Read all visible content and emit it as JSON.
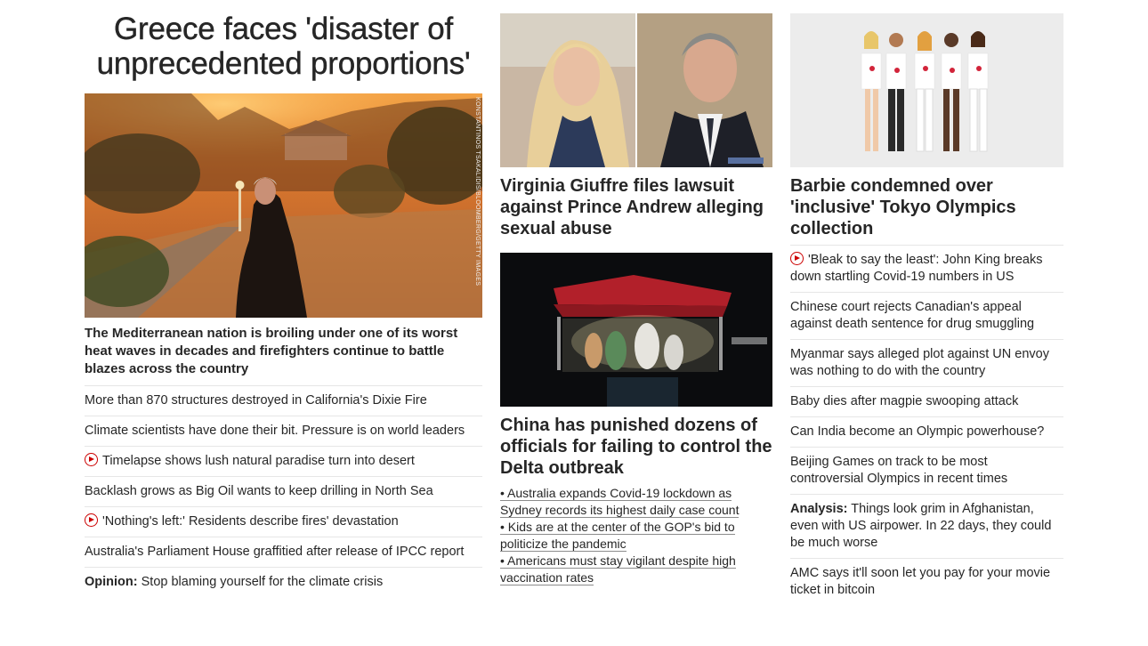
{
  "hero": {
    "title": "Greece faces 'disaster of unprecedented proportions'",
    "image_credit": "KONSTANTINOS TSAKALIDIS/BLOOMBERG/GETTY IMAGES",
    "subtitle": "The Mediterranean nation is broiling under one of its worst heat waves in decades and firefighters continue to battle blazes across the country",
    "links": [
      {
        "text": "More than 870 structures destroyed in California's Dixie Fire",
        "video": false
      },
      {
        "text": "Climate scientists have done their bit. Pressure is on world leaders",
        "video": false
      },
      {
        "text": "Timelapse shows lush natural paradise turn into desert",
        "video": true
      },
      {
        "text": "Backlash grows as Big Oil wants to keep drilling in North Sea",
        "video": false
      },
      {
        "text": "'Nothing's left:' Residents describe fires' devastation",
        "video": true
      },
      {
        "text": "Australia's Parliament House graffitied after release of IPCC report",
        "video": false
      }
    ],
    "opinion": {
      "label": "Opinion:",
      "text": " Stop blaming yourself for the climate crisis"
    }
  },
  "middle": {
    "story1": {
      "title": "Virginia Giuffre files lawsuit against Prince Andrew alleging sexual abuse"
    },
    "story2": {
      "title": "China has punished dozens of officials for failing to control the Delta outbreak",
      "bullets": [
        "• Australia expands Covid-19 lockdown as Sydney records its highest daily case count",
        "• Kids are at the center of the GOP's bid to politicize the pandemic",
        "• Americans must stay vigilant despite high vaccination rates"
      ]
    }
  },
  "right": {
    "story": {
      "title": "Barbie condemned over 'inclusive' Tokyo Olympics collection"
    },
    "links": [
      {
        "text": "'Bleak to say the least': John King breaks down startling Covid-19 numbers in US",
        "video": true
      },
      {
        "text": "Chinese court rejects Canadian's appeal against death sentence for drug smuggling",
        "video": false
      },
      {
        "text": "Myanmar says alleged plot against UN envoy was nothing to do with the country",
        "video": false
      },
      {
        "text": "Baby dies after magpie swooping attack",
        "video": false
      },
      {
        "text": "Can India become an Olympic powerhouse?",
        "video": false
      },
      {
        "text": "Beijing Games on track to be most controversial Olympics in recent times",
        "video": false
      }
    ],
    "analysis": {
      "label": "Analysis:",
      "text": " Things look grim in Afghanistan, even with US airpower. In 22 days, they could be much worse"
    },
    "last": {
      "text": "AMC says it'll soon let you pay for your movie ticket in bitcoin"
    }
  },
  "colors": {
    "text": "#262626",
    "divider": "#e6e6e6",
    "video_red": "#cc0000"
  }
}
